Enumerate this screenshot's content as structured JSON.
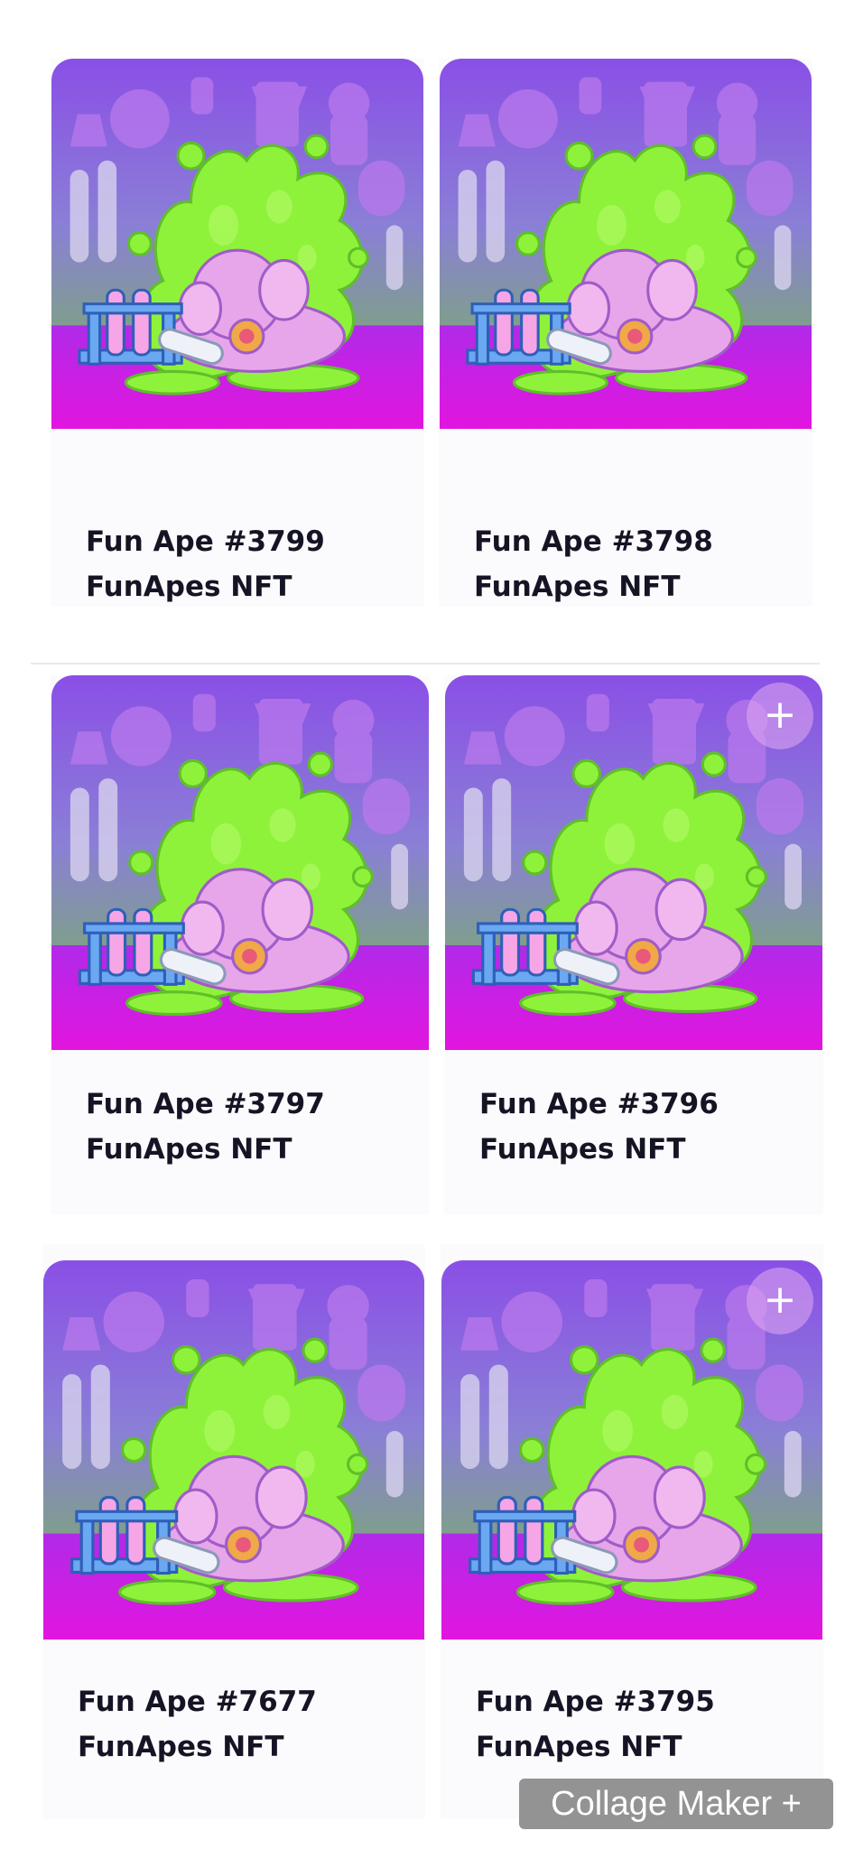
{
  "cards": [
    {
      "title": "Fun Ape #3799",
      "collection": "FunApes NFT"
    },
    {
      "title": "Fun Ape #3798",
      "collection": "FunApes NFT"
    },
    {
      "title": "Fun Ape #3797",
      "collection": "FunApes NFT"
    },
    {
      "title": "Fun Ape #3796",
      "collection": "FunApes NFT"
    },
    {
      "title": "Fun Ape #7677",
      "collection": "FunApes NFT"
    },
    {
      "title": "Fun Ape #3795",
      "collection": "FunApes NFT"
    }
  ],
  "add_button_label": "+",
  "watermark": "Collage Maker +",
  "colors": {
    "art_background_top": "#8a4fe6",
    "art_table": "#c61ee8",
    "slime": "#8ff23a",
    "ape_pink": "#e7a6ea",
    "text": "#141424"
  }
}
